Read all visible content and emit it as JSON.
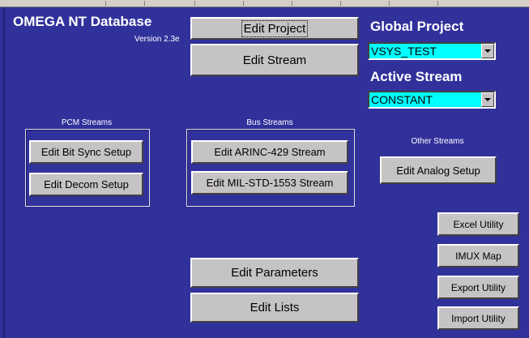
{
  "app": {
    "title": "OMEGA NT Database",
    "version": "Version 2.3e"
  },
  "top_buttons": {
    "edit_project": "Edit Project",
    "edit_stream": "Edit Stream"
  },
  "global_project": {
    "label": "Global Project",
    "value": "VSYS_TEST"
  },
  "active_stream": {
    "label": "Active Stream",
    "value": "CONSTANT"
  },
  "pcm_streams": {
    "label": "PCM Streams",
    "bit_sync": "Edit Bit Sync Setup",
    "decom": "Edit Decom Setup"
  },
  "bus_streams": {
    "label": "Bus Streams",
    "arinc": "Edit ARINC-429 Stream",
    "milstd": "Edit MIL-STD-1553 Stream"
  },
  "other_streams": {
    "label": "Other Streams",
    "analog": "Edit Analog Setup"
  },
  "bottom_buttons": {
    "parameters": "Edit Parameters",
    "lists": "Edit Lists"
  },
  "utilities": {
    "excel": "Excel Utility",
    "imux": "IMUX Map",
    "export": "Export Utility",
    "import": "Import Utility"
  },
  "colors": {
    "background": "#31319c",
    "button_face": "#c6c3c6",
    "combo_fill": "#00ffff"
  }
}
